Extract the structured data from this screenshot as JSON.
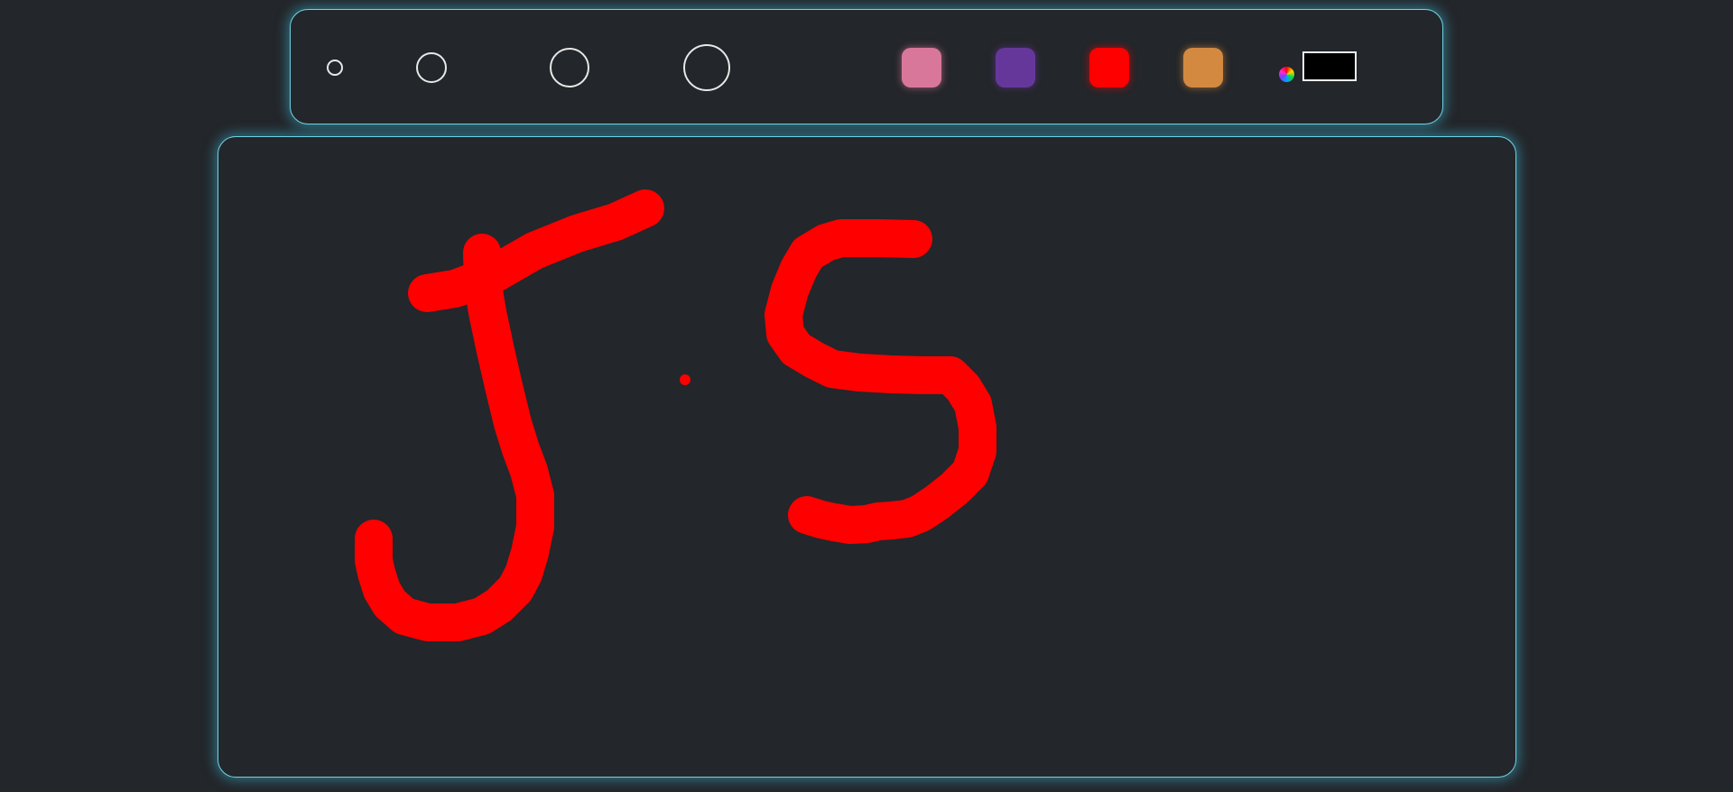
{
  "toolbar": {
    "brush_sizes": [
      "small",
      "medium",
      "large",
      "extra-large"
    ],
    "colors": [
      {
        "name": "pink",
        "hex": "#d9779a"
      },
      {
        "name": "purple",
        "hex": "#66379b"
      },
      {
        "name": "red",
        "hex": "#ff0000"
      },
      {
        "name": "orange",
        "hex": "#d3893f"
      }
    ],
    "custom_color": {
      "value": "#000000",
      "icon": "color-wheel-icon"
    }
  },
  "canvas": {
    "stroke_color": "#ff0000",
    "background": "#23262a"
  }
}
